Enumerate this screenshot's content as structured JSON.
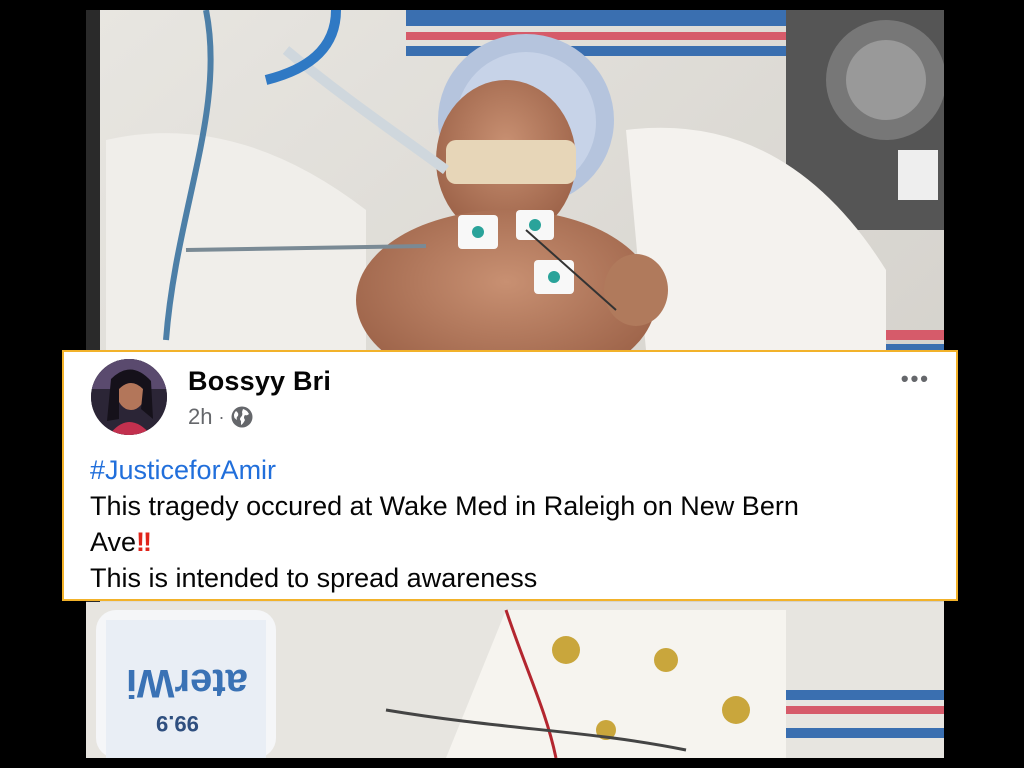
{
  "photo": {
    "description_icon": "photo-image",
    "watermark_text": "99.9",
    "brand_text": "aterWi"
  },
  "post": {
    "author": "Bossyy Bri",
    "time": "2h",
    "separator": "·",
    "privacy_icon": "globe-icon",
    "more_icon": "•••",
    "hashtag": "#JusticeforAmir",
    "line1": "This tragedy occured at Wake Med in Raleigh on New Bern",
    "line2": "Ave",
    "emoji": "!!",
    "line3": "This is intended to spread awareness"
  },
  "colors": {
    "card_border": "#f2b22a",
    "hashtag": "#216fdb",
    "meta_text": "#65676b"
  }
}
